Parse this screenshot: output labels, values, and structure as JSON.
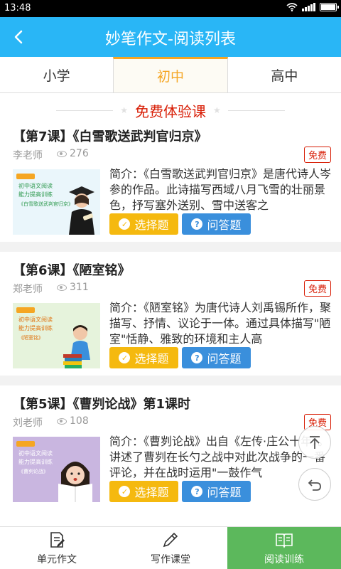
{
  "status_bar": {
    "time": "13:48"
  },
  "header": {
    "title": "妙笔作文-阅读列表",
    "back_symbol": "‹"
  },
  "tabs": [
    {
      "label": "小学",
      "active": false
    },
    {
      "label": "初中",
      "active": true
    },
    {
      "label": "高中",
      "active": false
    }
  ],
  "section": {
    "heading": "免费体验课"
  },
  "courses": [
    {
      "title": "【第7课】《白雪歌送武判官归京》",
      "teacher": "李老师",
      "views": "276",
      "badge": "免费",
      "intro": "简介：《白雪歌送武判官归京》是唐代诗人岑参的作品。此诗描写西域八月飞雪的壮丽景色，抒写塞外送别、雪中送客之",
      "thumb_line1": "初中语文阅读",
      "thumb_line2": "能力提高训练",
      "thumb_line3": "《白雪歌送武判官归京》",
      "thumb_bg": "#eaf6fb",
      "thumb_text_color": "#2f9a4f",
      "btn_choice": "选择题",
      "btn_qa": "问答题"
    },
    {
      "title": "【第6课】《陋室铭》",
      "teacher": "郑老师",
      "views": "311",
      "badge": "免费",
      "intro": "简介：《陋室铭》为唐代诗人刘禹锡所作，聚描写、抒情、议论于一体。通过具体描写\"陋室\"恬静、雅致的环境和主人高",
      "thumb_line1": "初中语文阅读",
      "thumb_line2": "能力提高训练",
      "thumb_line3": "《陋室铭》",
      "thumb_bg": "#e6f3dc",
      "thumb_text_color": "#e0720e",
      "btn_choice": "选择题",
      "btn_qa": "问答题"
    },
    {
      "title": "【第5课】《曹刿论战》第1课时",
      "teacher": "刘老师",
      "views": "108",
      "badge": "免费",
      "intro": "简介：《曹刿论战》出自《左传·庄公十年》。讲述了曹刿在长勺之战中对此次战争的一番评论，并在战时运用\"一鼓作气",
      "thumb_line1": "初中语文阅读",
      "thumb_line2": "能力提高训练",
      "thumb_line3": "《曹刿论战》",
      "thumb_bg": "#c9b6e0",
      "thumb_text_color": "#ffffff",
      "btn_choice": "选择题",
      "btn_qa": "问答题"
    }
  ],
  "bottom_nav": [
    {
      "label": "单元作文",
      "icon": "document-edit-icon",
      "active": false
    },
    {
      "label": "写作课堂",
      "icon": "pencil-icon",
      "active": false
    },
    {
      "label": "阅读训练",
      "icon": "open-book-icon",
      "active": true
    }
  ],
  "colors": {
    "header_bg": "#29b6f6",
    "active_tab": "#f5a623",
    "free_red": "#d81e06",
    "choice_btn": "#f5b90f",
    "qa_btn": "#3a8fdc",
    "nav_active": "#5cb85c"
  }
}
